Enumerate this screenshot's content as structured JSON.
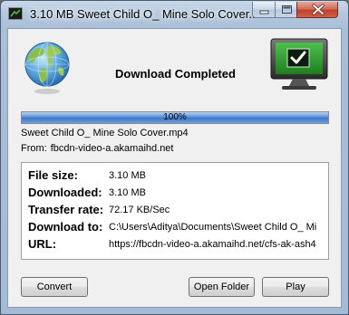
{
  "window": {
    "title": "3.10 MB Sweet Child O_ Mine Solo Cover...",
    "controls": {
      "minimize": "minimize-icon",
      "maximize": "maximize-icon",
      "close": "close-icon"
    }
  },
  "header": {
    "headline": "Download Completed",
    "left_icon": "globe-icon",
    "right_icon": "monitor-check-icon"
  },
  "progress": {
    "value": 1.0,
    "label": "100%",
    "color": "#3f77c7"
  },
  "file": {
    "name": "Sweet Child O_ Mine Solo Cover.mp4",
    "from_label": "From:",
    "from_value": "fbcdn-video-a.akamaihd.net"
  },
  "details": [
    {
      "label": "File size:",
      "value": "3.10 MB"
    },
    {
      "label": "Downloaded:",
      "value": "3.10 MB"
    },
    {
      "label": "Transfer rate:",
      "value": "72.17 KB/Sec"
    },
    {
      "label": "Download to:",
      "value": "C:\\Users\\Aditya\\Documents\\Sweet Child O_ Mi"
    },
    {
      "label": "URL:",
      "value": "https://fbcdn-video-a.akamaihd.net/cfs-ak-ash4"
    }
  ],
  "buttons": {
    "convert": "Convert",
    "open_folder": "Open Folder",
    "play": "Play"
  },
  "colors": {
    "title_bar": "#b4c8de",
    "close_button": "#c0412a",
    "client_bg": "#f0f0f0",
    "monitor_screen": "#2a8a2a"
  }
}
